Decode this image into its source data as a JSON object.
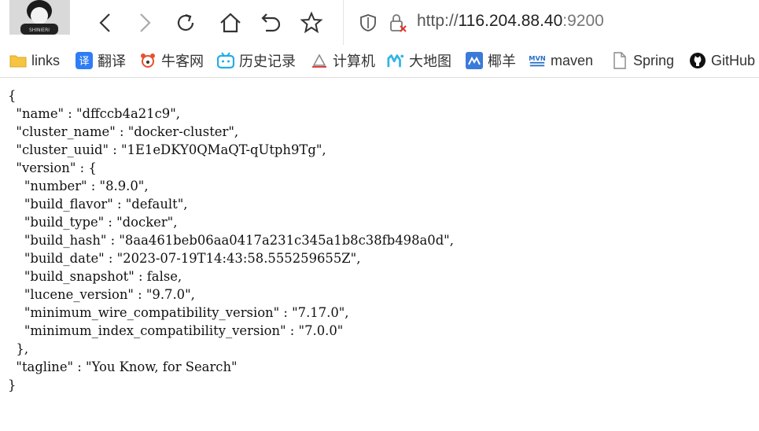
{
  "toolbar": {
    "url_scheme": "http://",
    "url_host": "116.204.88.40",
    "url_port": ":9200",
    "icons": [
      "back-icon",
      "forward-icon",
      "reload-icon",
      "home-icon",
      "undo-icon",
      "star-icon",
      "shield-icon",
      "insecure-lock-icon"
    ]
  },
  "bookmarks": [
    {
      "label": "links",
      "icon": "folder-icon",
      "color": "#f5c542"
    },
    {
      "label": "翻译",
      "icon": "translate-icon",
      "color": "#2f7df6"
    },
    {
      "label": "牛客网",
      "icon": "nowcoder-icon",
      "color": "#e8502f"
    },
    {
      "label": "历史记录",
      "icon": "bilibili-icon",
      "color": "#23ade5"
    },
    {
      "label": "计算机",
      "icon": "computer-icon",
      "color": "#666666"
    },
    {
      "label": "大地图",
      "icon": "map-icon",
      "color": "#34b4e6"
    },
    {
      "label": "椰羊",
      "icon": "yeyang-icon",
      "color": "#3b7ad8"
    },
    {
      "label": "maven",
      "icon": "mvn-icon",
      "color": "#2a6fc9"
    },
    {
      "label": "Spring",
      "icon": "page-icon",
      "color": "#888888"
    },
    {
      "label": "GitHub",
      "icon": "github-icon",
      "color": "#111111"
    }
  ],
  "json_response": {
    "line_01": "{",
    "line_02": "  \"name\" : \"dffccb4a21c9\",",
    "line_03": "  \"cluster_name\" : \"docker-cluster\",",
    "line_04": "  \"cluster_uuid\" : \"1E1eDKY0QMaQT-qUtph9Tg\",",
    "line_05": "  \"version\" : {",
    "line_06": "    \"number\" : \"8.9.0\",",
    "line_07": "    \"build_flavor\" : \"default\",",
    "line_08": "    \"build_type\" : \"docker\",",
    "line_09": "    \"build_hash\" : \"8aa461beb06aa0417a231c345a1b8c38fb498a0d\",",
    "line_10": "    \"build_date\" : \"2023-07-19T14:43:58.555259655Z\",",
    "line_11": "    \"build_snapshot\" : false,",
    "line_12": "    \"lucene_version\" : \"9.7.0\",",
    "line_13": "    \"minimum_wire_compatibility_version\" : \"7.17.0\",",
    "line_14": "    \"minimum_index_compatibility_version\" : \"7.0.0\"",
    "line_15": "  },",
    "line_16": "  \"tagline\" : \"You Know, for Search\"",
    "line_17": "}"
  }
}
